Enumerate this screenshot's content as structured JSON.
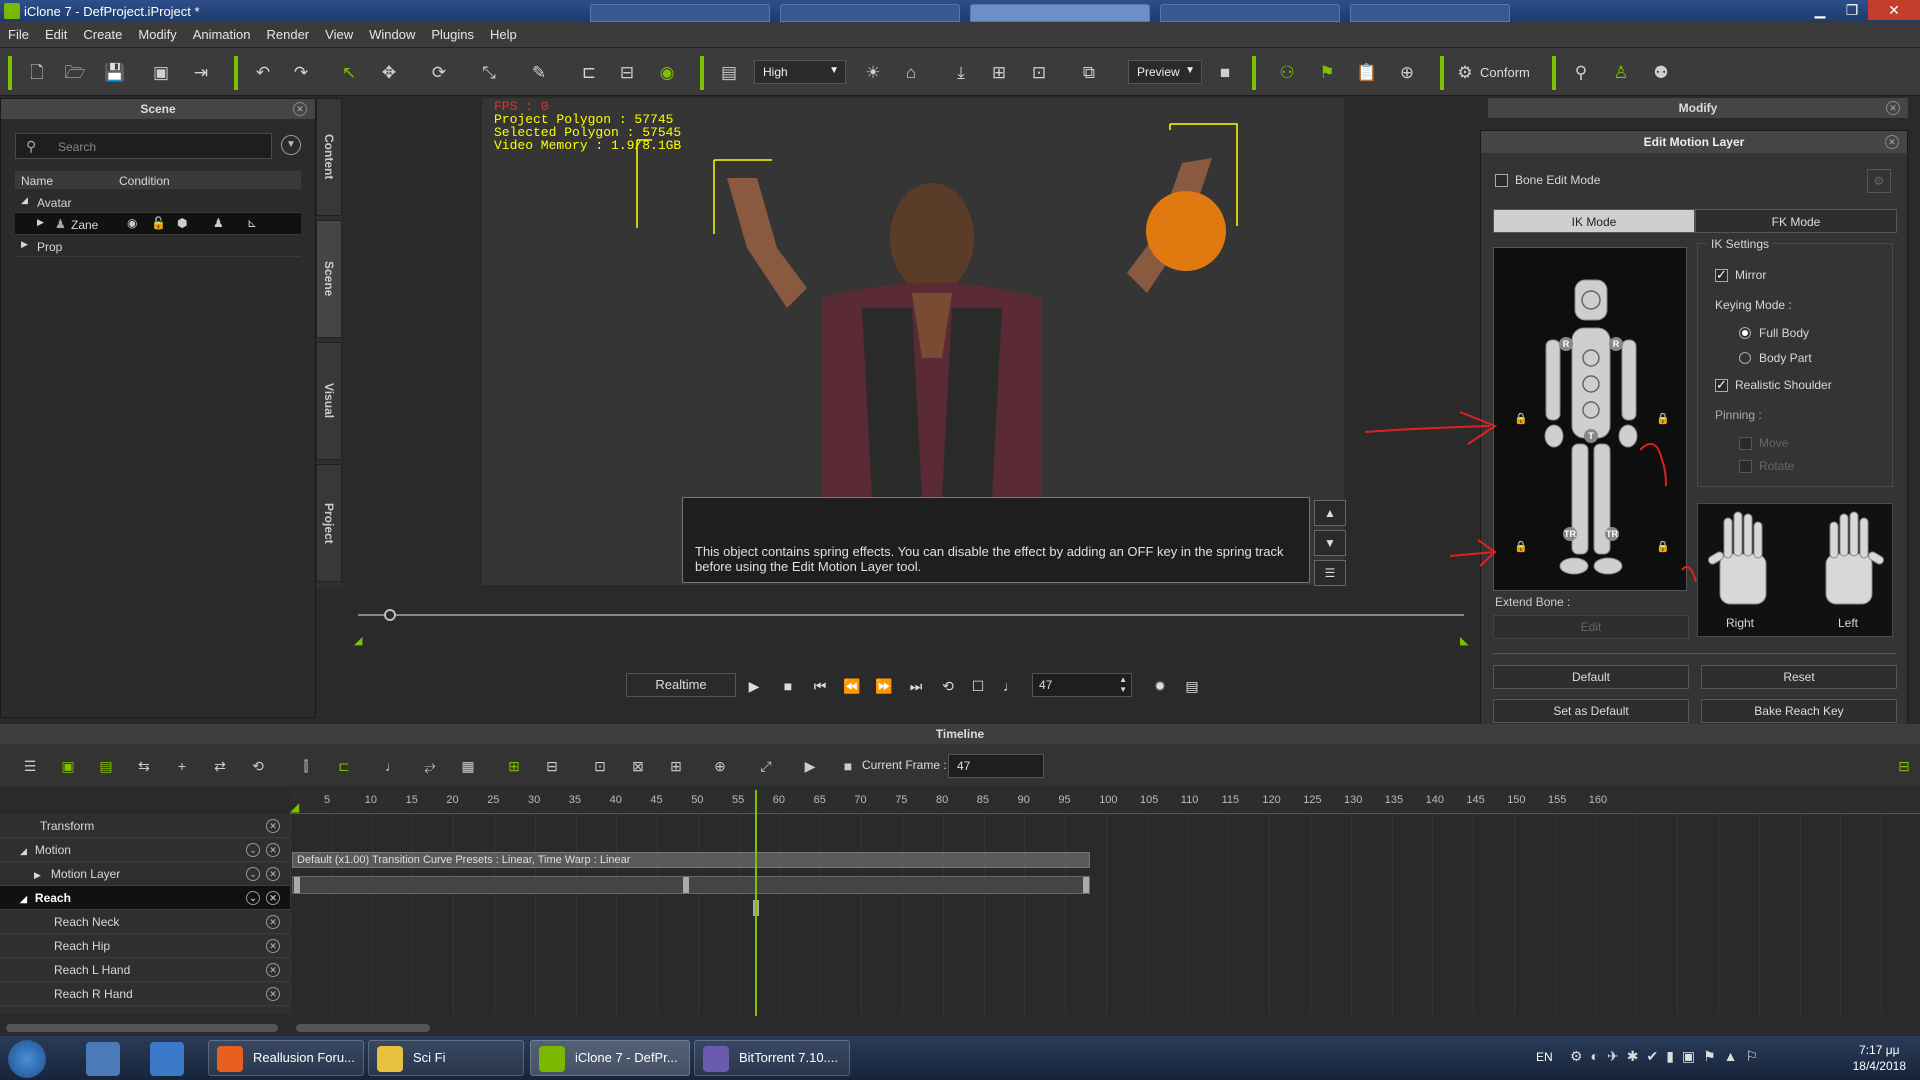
{
  "window": {
    "title": "iClone 7 - DefProject.iProject *"
  },
  "menu": [
    "File",
    "Edit",
    "Create",
    "Modify",
    "Animation",
    "Render",
    "View",
    "Window",
    "Plugins",
    "Help"
  ],
  "toolbar": {
    "quality": "High",
    "preview": "Preview",
    "conform": "Conform"
  },
  "scene_panel": {
    "title": "Scene",
    "search_placeholder": "Search",
    "col_name": "Name",
    "col_condition": "Condition",
    "rows": [
      {
        "label": "Avatar"
      },
      {
        "label": "Zane"
      },
      {
        "label": "Prop"
      }
    ]
  },
  "side_tabs": [
    "Content",
    "Scene",
    "Visual",
    "Project"
  ],
  "hud": {
    "fps": "FPS : 0",
    "project_polygon": "Project Polygon : 57745",
    "selected_polygon": "Selected Polygon : 57545",
    "video_memory": "Video Memory : 1.9/8.1GB"
  },
  "notice": "This object contains spring effects.  You can disable the effect by adding an OFF key in the spring track before using the Edit Motion Layer tool.",
  "playback": {
    "mode": "Realtime",
    "frame": "47"
  },
  "modify_panel": {
    "title": "Modify"
  },
  "edit_motion_layer": {
    "title": "Edit Motion Layer",
    "bone_edit_mode": "Bone Edit Mode",
    "ik_mode": "IK Mode",
    "fk_mode": "FK Mode",
    "ik_settings": "IK Settings",
    "mirror": "Mirror",
    "keying_mode": "Keying Mode :",
    "full_body": "Full Body",
    "body_part": "Body Part",
    "realistic_shoulder": "Realistic Shoulder",
    "pinning": "Pinning :",
    "move": "Move",
    "rotate": "Rotate",
    "extend_bone": "Extend Bone :",
    "edit": "Edit",
    "right": "Right",
    "left": "Left",
    "default": "Default",
    "reset": "Reset",
    "set_as_default": "Set as Default",
    "bake_reach_key": "Bake Reach Key",
    "markers": {
      "r": "R",
      "t": "T",
      "tr": "TR"
    }
  },
  "timeline": {
    "title": "Timeline",
    "current_frame_label": "Current Frame :",
    "current_frame": "47",
    "ticks": [
      "5",
      "10",
      "15",
      "20",
      "25",
      "30",
      "35",
      "40",
      "45",
      "50",
      "55",
      "60",
      "65",
      "70",
      "75",
      "80",
      "85",
      "90",
      "95",
      "100",
      "105",
      "110",
      "115",
      "120",
      "125",
      "130",
      "135",
      "140",
      "145",
      "150",
      "155",
      "160"
    ],
    "tracks": [
      {
        "label": "Transform"
      },
      {
        "label": "Motion"
      },
      {
        "label": "Motion Layer"
      },
      {
        "label": "Reach"
      },
      {
        "label": "Reach Neck"
      },
      {
        "label": "Reach Hip"
      },
      {
        "label": "Reach L Hand"
      },
      {
        "label": "Reach R Hand"
      }
    ],
    "motion_clip": "Default (x1.00) Transition Curve Presets : Linear, Time Warp : Linear"
  },
  "taskbar": {
    "tasks": [
      "Reallusion Foru...",
      "Sci Fi",
      "iClone 7 - DefPr...",
      "BitTorrent 7.10...."
    ],
    "lang": "EN",
    "time": "7:17 μμ",
    "date": "18/4/2018"
  },
  "colors": {
    "accent": "#7fc100",
    "orange_ball": "#e07a10",
    "hud": "#ffff00"
  }
}
